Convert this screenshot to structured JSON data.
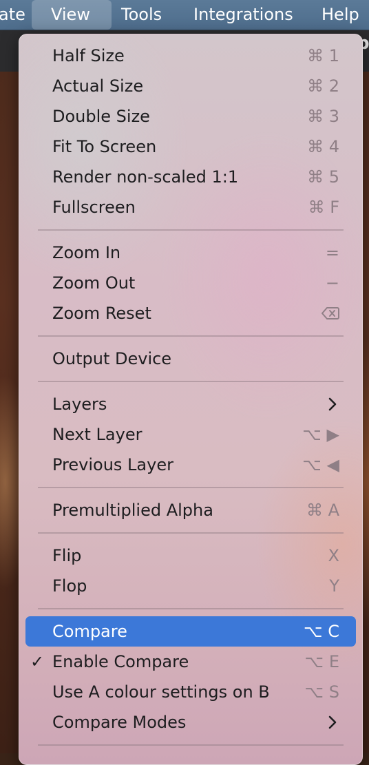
{
  "menubar": {
    "items": [
      "ate",
      "View",
      "Tools",
      "Integrations",
      "Help"
    ],
    "active": "View"
  },
  "window_title_fragment": "p",
  "menu": {
    "items": [
      {
        "label": "Half Size",
        "shortcut": "⌘ 1"
      },
      {
        "label": "Actual Size",
        "shortcut": "⌘ 2"
      },
      {
        "label": "Double Size",
        "shortcut": "⌘ 3"
      },
      {
        "label": "Fit To Screen",
        "shortcut": "⌘ 4"
      },
      {
        "label": "Render non-scaled 1:1",
        "shortcut": "⌘ 5"
      },
      {
        "label": "Fullscreen",
        "shortcut": "⌘ F"
      },
      {
        "label": "Zoom In",
        "shortcut": "="
      },
      {
        "label": "Zoom Out",
        "shortcut": "−"
      },
      {
        "label": "Zoom Reset",
        "shortcut_icon": "delete-backward-icon"
      },
      {
        "label": "Output Device",
        "shortcut": ""
      },
      {
        "label": "Layers",
        "submenu": true
      },
      {
        "label": "Next Layer",
        "shortcut": "⌥ ▶"
      },
      {
        "label": "Previous Layer",
        "shortcut": "⌥ ◀"
      },
      {
        "label": "Premultiplied Alpha",
        "shortcut": "⌘ A"
      },
      {
        "label": "Flip",
        "shortcut": "X"
      },
      {
        "label": "Flop",
        "shortcut": "Y"
      },
      {
        "label": "Compare",
        "shortcut": "⌥ C",
        "highlighted": true
      },
      {
        "label": "Enable Compare",
        "shortcut": "⌥ E",
        "checked": true,
        "check_glyph": "✓"
      },
      {
        "label": "Use A colour settings on B",
        "shortcut": "⌥ S"
      },
      {
        "label": "Compare Modes",
        "submenu": true
      }
    ]
  },
  "colors": {
    "menubar": "#4e6d8c",
    "highlight": "#3c78d8",
    "text": "#1d1d1f",
    "shortcut_text": "#8f7f86"
  }
}
